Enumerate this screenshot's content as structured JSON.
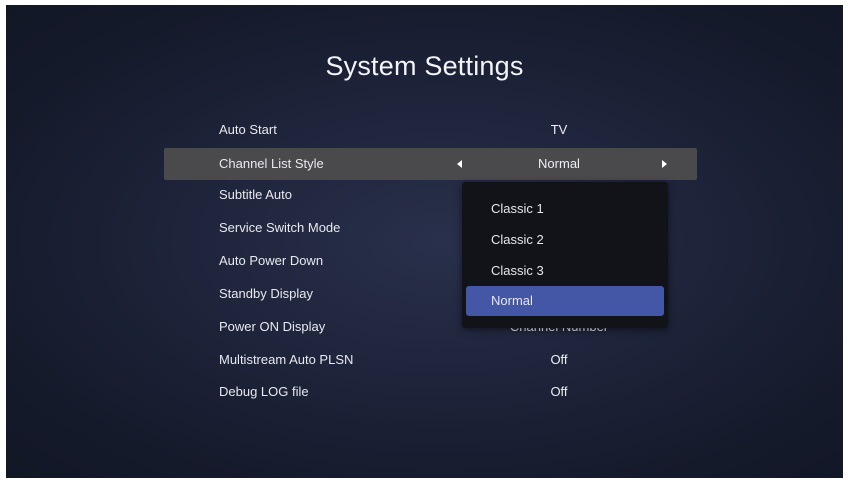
{
  "page": {
    "title": "System Settings"
  },
  "settings": [
    {
      "label": "Auto Start",
      "value": "TV"
    },
    {
      "label": "Channel List Style",
      "value": "Normal"
    },
    {
      "label": "Subtitle Auto",
      "value": ""
    },
    {
      "label": "Service Switch Mode",
      "value": ""
    },
    {
      "label": "Auto Power Down",
      "value": ""
    },
    {
      "label": "Standby Display",
      "value": ""
    },
    {
      "label": "Power ON Display",
      "value": "Channel Number"
    },
    {
      "label": "Multistream Auto PLSN",
      "value": "Off"
    },
    {
      "label": "Debug LOG file",
      "value": "Off"
    }
  ],
  "dropdown": {
    "options": [
      "Classic 1",
      "Classic 2",
      "Classic 3",
      "Normal"
    ],
    "selected": "Normal"
  },
  "icons": {
    "left_arrow": "caret-left-icon",
    "right_arrow": "caret-right-icon"
  },
  "colors": {
    "background": "#1f253c",
    "selected_row": "#4a4a4d",
    "dropdown_bg": "#111318",
    "highlight": "#4456a6",
    "text": "#e8e9ee"
  }
}
